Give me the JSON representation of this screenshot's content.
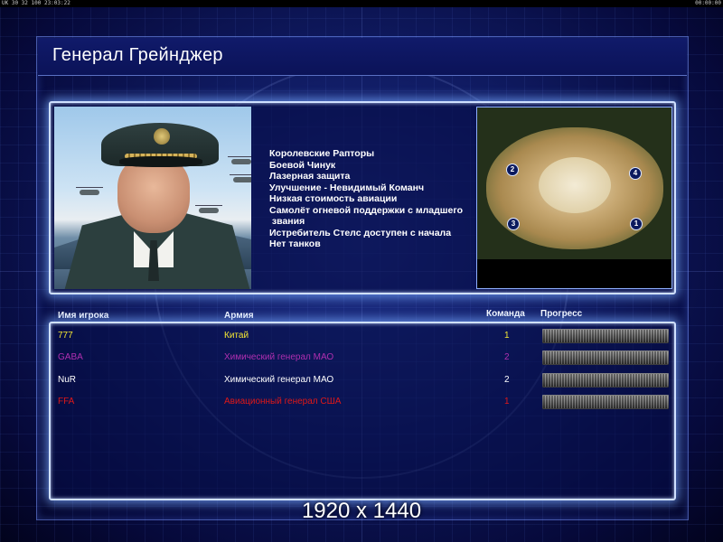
{
  "topbar": {
    "left_text": "UK 30 32 100 23:03:22",
    "right_text": "00:00:00"
  },
  "general": {
    "name": "Генерал Грейнджер",
    "traits": [
      "Королевские Рапторы",
      "Боевой Чинук",
      "Лазерная защита",
      "Улучшение - Невидимый Команч",
      "Низкая стоимость авиации",
      "Самолёт огневой поддержки с младшего",
      " звания",
      "Истребитель Стелс доступен с начала",
      "Нет танков"
    ]
  },
  "map": {
    "start_positions": [
      "2",
      "4",
      "3",
      "1"
    ]
  },
  "table": {
    "headers": {
      "player": "Имя игрока",
      "army": "Армия",
      "team": "Команда",
      "progress": "Прогресс"
    },
    "rows": [
      {
        "player": "777",
        "army": "Китай",
        "team": "1",
        "color": "#f5e733",
        "progress": 1.0
      },
      {
        "player": "GABA",
        "army": "Химический генерал МАО",
        "team": "2",
        "color": "#b02fb0",
        "progress": 1.0
      },
      {
        "player": "NuR",
        "army": "Химический генерал МАО",
        "team": "2",
        "color": "#ffffff",
        "progress": 1.0
      },
      {
        "player": "FFA",
        "army": "Авиационный генерал США",
        "team": "1",
        "color": "#e01818",
        "progress": 1.0
      }
    ]
  },
  "watermark": {
    "resolution": "1920 x 1440"
  }
}
